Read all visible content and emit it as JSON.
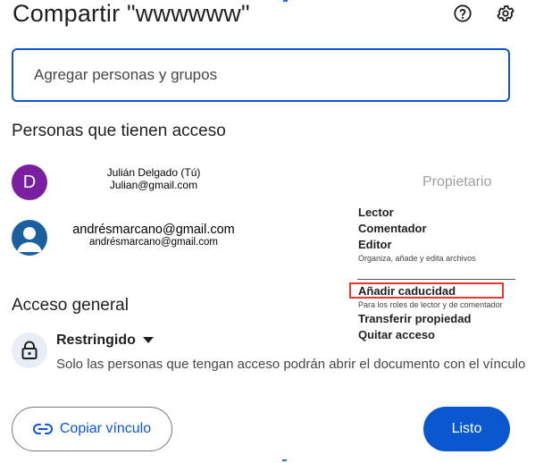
{
  "dialog": {
    "title": "Compartir \"wwwwww\"",
    "help_icon": "help-circle-icon",
    "settings_icon": "gear-icon"
  },
  "search": {
    "placeholder": "Agregar personas y grupos",
    "value": ""
  },
  "people": {
    "section_title": "Personas que tienen acceso",
    "list": [
      {
        "avatar_letter": "D",
        "avatar_color": "#7b1fa2",
        "name": "Julián Delgado (Tú)",
        "email": "Julian@gmail.com",
        "role": "Propietario"
      },
      {
        "avatar_icon": "person-icon",
        "avatar_color": "#1a5fa0",
        "email": "andrésmarcano@gmail.com",
        "email_secondary": "andrésmarcano@gmail.com"
      }
    ]
  },
  "role_menu": {
    "items": [
      {
        "label": "Lector"
      },
      {
        "label": "Comentador"
      },
      {
        "label": "Editor",
        "description": "Organiza, añade y edita archivos"
      }
    ],
    "expiration": {
      "label": "Añadir caducidad",
      "description": "Para los roles de lector y de comentador",
      "highlight_color": "#e53935"
    },
    "transfer": "Transferir propiedad",
    "remove": "Quitar acceso"
  },
  "general_access": {
    "section_title": "Acceso general",
    "icon": "lock-icon",
    "mode": "Restringido",
    "description": "Solo las personas que tengan acceso podrán abrir el documento con el vínculo"
  },
  "footer": {
    "copy_link_label": "Copiar vínculo",
    "copy_link_icon": "link-icon",
    "done_label": "Listo"
  },
  "colors": {
    "accent": "#0b57d0",
    "highlight": "#e53935"
  }
}
